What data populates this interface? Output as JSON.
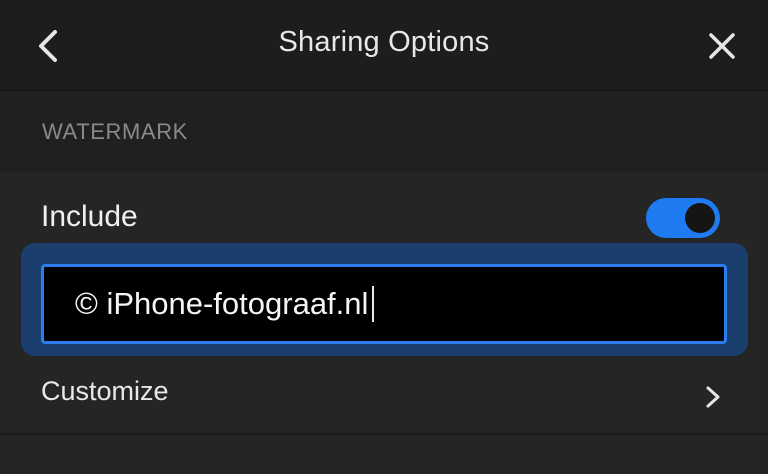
{
  "header": {
    "title": "Sharing Options",
    "back_icon": "chevron-left-icon",
    "close_icon": "close-icon"
  },
  "watermark": {
    "section_heading": "WATERMARK",
    "include_label": "Include",
    "include_enabled": true,
    "text_value": "© iPhone-fotograaf.nl",
    "customize_label": "Customize",
    "customize_icon": "chevron-right-icon"
  },
  "colors": {
    "accent": "#1f7bf2",
    "background": "#252525",
    "header_background": "#1d1d1d",
    "field_background": "#000000",
    "focus_ring": "#1a3f6d",
    "section_heading": "#8a8a8a"
  }
}
